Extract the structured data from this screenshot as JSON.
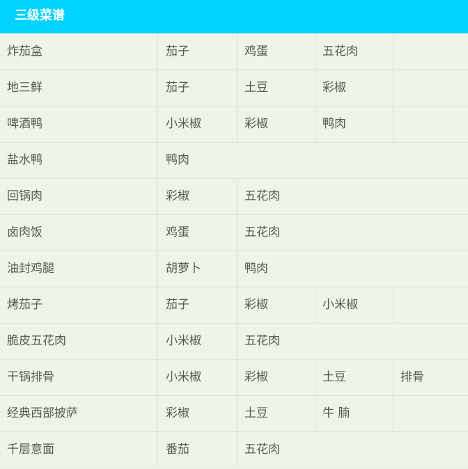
{
  "header": {
    "title": "三级菜谱"
  },
  "recipes": [
    {
      "name": "炸茄盒",
      "ingredients": [
        "茄子",
        "鸡蛋",
        "五花肉",
        ""
      ]
    },
    {
      "name": "地三鲜",
      "ingredients": [
        "茄子",
        "土豆",
        "彩椒",
        ""
      ]
    },
    {
      "name": "啤酒鸭",
      "ingredients": [
        "小米椒",
        "彩椒",
        "鸭肉",
        ""
      ]
    },
    {
      "name": "盐水鸭",
      "ingredients": [
        "鸭肉"
      ]
    },
    {
      "name": "回锅肉",
      "ingredients": [
        "彩椒",
        "五花肉"
      ]
    },
    {
      "name": "卤肉饭",
      "ingredients": [
        "鸡蛋",
        "五花肉"
      ]
    },
    {
      "name": "油封鸡腿",
      "ingredients": [
        "胡萝卜",
        "鸭肉"
      ]
    },
    {
      "name": "烤茄子",
      "ingredients": [
        "茄子",
        "彩椒",
        "小米椒",
        ""
      ]
    },
    {
      "name": "脆皮五花肉",
      "ingredients": [
        "小米椒",
        "五花肉"
      ]
    },
    {
      "name": "干锅排骨",
      "ingredients": [
        "小米椒",
        "彩椒",
        "土豆",
        "排骨"
      ]
    },
    {
      "name": "经典西部披萨",
      "ingredients": [
        "彩椒",
        "土豆",
        "牛 腩",
        ""
      ]
    },
    {
      "name": "千层意面",
      "ingredients": [
        "番茄",
        "五花肉"
      ]
    }
  ]
}
